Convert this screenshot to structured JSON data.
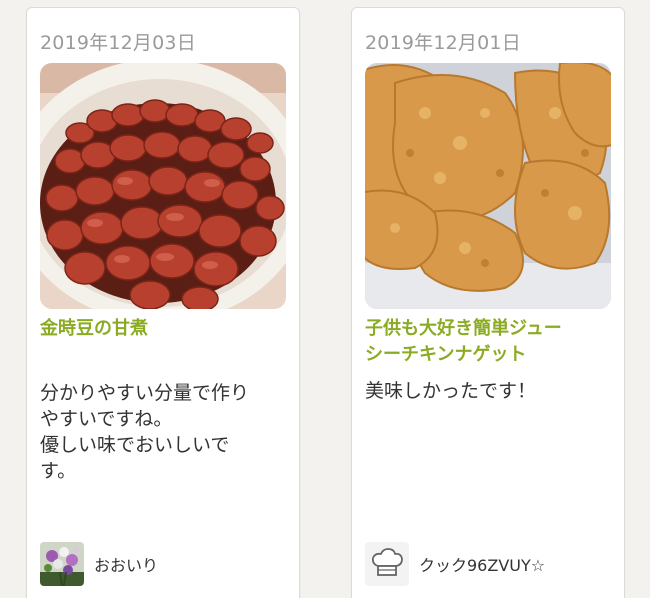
{
  "cards": [
    {
      "date": "2019年12月03日",
      "photo_icon": "kidney-beans-photo",
      "title": "金時豆の甘煮",
      "comment_lines": [
        "分かりやすい分量で作り",
        "やすいですね。",
        "優しい味でおいしいで",
        "す。"
      ],
      "author": "おおいり",
      "avatar_icon": "flower-bouquet-avatar"
    },
    {
      "date": "2019年12月01日",
      "photo_icon": "fried-chicken-nuggets-photo",
      "title_lines": [
        "子供も大好き簡単ジュー",
        "シーチキンナゲット"
      ],
      "comment_lines": [
        "美味しかったです！"
      ],
      "author": "クック96ZVUY☆",
      "avatar_icon": "chef-hat-avatar"
    }
  ],
  "colors": {
    "title_green": "#8bab23",
    "date_gray": "#9a9a9a",
    "text": "#333333",
    "background": "#f4f2ee"
  }
}
